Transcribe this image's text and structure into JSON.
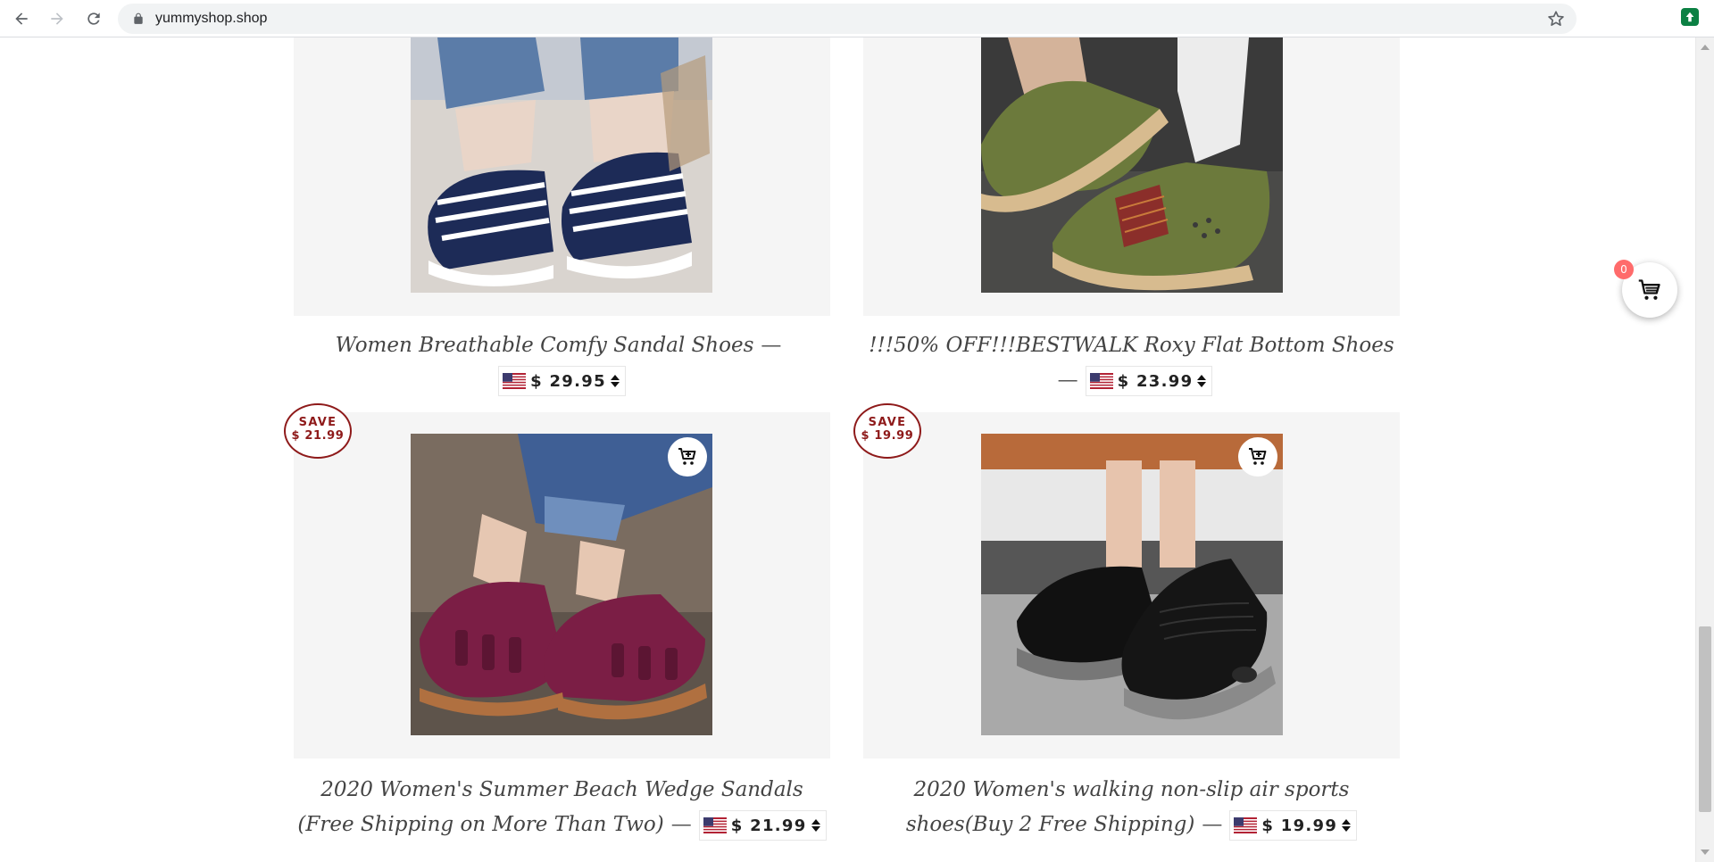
{
  "browser": {
    "url": "yummyshop.shop",
    "icons": [
      "back-icon",
      "forward-icon",
      "reload-icon",
      "lock-icon",
      "bookmark-star-icon",
      "extension-icon"
    ]
  },
  "products": [
    {
      "title": "Women Breathable Comfy Sandal Shoes",
      "price": "$ 29.95",
      "currency_flag": "us-flag-icon",
      "save_label": null,
      "save_amount": null,
      "quick_add": false,
      "image": "navy white striped knit sandals"
    },
    {
      "title": "!!!50% OFF!!!BESTWALK Roxy Flat Bottom Shoes",
      "price": "$ 23.99",
      "currency_flag": "us-flag-icon",
      "save_label": null,
      "save_amount": null,
      "quick_add": false,
      "image": "olive green slip-on flats"
    },
    {
      "title": "2020 Women's Summer Beach Wedge Sandals (Free Shipping on More Than Two)",
      "price": "$ 21.99",
      "currency_flag": "us-flag-icon",
      "save_label": "SAVE",
      "save_amount": "$ 21.99",
      "quick_add": true,
      "image": "burgundy closed-toe wedge sandals"
    },
    {
      "title": "2020 Women's walking non-slip air sports shoes(Buy 2 Free Shipping)",
      "price": "$ 19.99",
      "currency_flag": "us-flag-icon",
      "save_label": "SAVE",
      "save_amount": "$ 19.99",
      "quick_add": true,
      "image": "black knit air-cushion sneakers"
    }
  ],
  "cart": {
    "count": "0",
    "icon": "cart-icon"
  },
  "colors": {
    "card_bg": "#f5f5f5",
    "badge_red": "#8e1a1a",
    "cart_badge": "#ff6b6b",
    "title_text": "#444444"
  }
}
